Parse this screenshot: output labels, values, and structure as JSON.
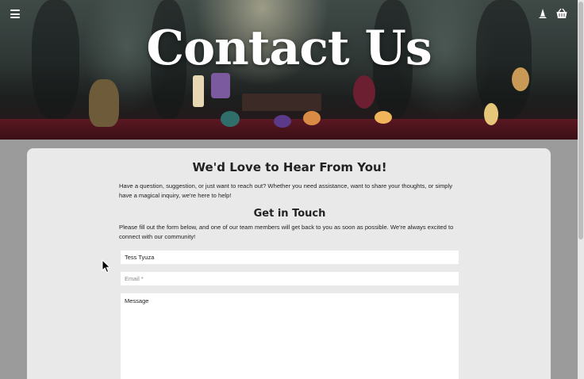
{
  "hero": {
    "title": "Contact Us",
    "icons": [
      "menu-icon",
      "wizard-hat-icon",
      "basket-icon"
    ]
  },
  "card": {
    "heading": "We'd Love to Hear From You!",
    "intro": "Have a question, suggestion, or just want to reach out? Whether you need assistance, want to share your thoughts, or simply have a magical inquiry, we're here to help!",
    "subheading": "Get in Touch",
    "instructions": "Please fill out the form below, and one of our team members will get back to you as soon as possible. We're always excited to connect with our community!"
  },
  "form": {
    "name_value": "Tess Tyuza",
    "email_placeholder": "Email *",
    "message_placeholder": "Message"
  },
  "colors": {
    "page_bg": "#9b9b9b",
    "card_bg": "#e9e9e9",
    "table_red": "#5a1822"
  }
}
